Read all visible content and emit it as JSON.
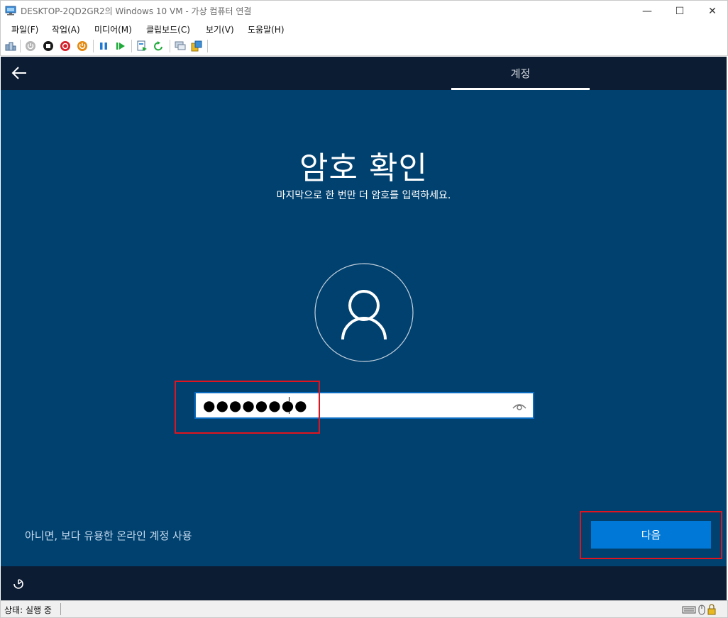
{
  "window": {
    "title": "DESKTOP-2QD2GR2의 Windows 10 VM - 가상 컴퓨터 연결",
    "minimize_symbol": "—",
    "maximize_symbol": "☐",
    "close_symbol": "✕"
  },
  "menu": {
    "items": [
      {
        "label": "파일(F)"
      },
      {
        "label": "작업(A)"
      },
      {
        "label": "미디어(M)"
      },
      {
        "label": "클립보드(C)"
      },
      {
        "label": "보기(V)"
      },
      {
        "label": "도움말(H)"
      }
    ]
  },
  "toolbar": {
    "icons": [
      "ctrl-alt-del-icon",
      "start-icon",
      "turn-off-icon",
      "shut-down-icon",
      "save-state-icon",
      "pause-icon",
      "resume-icon",
      "checkpoint-icon",
      "revert-icon",
      "enhanced-session-icon",
      "share-icon"
    ]
  },
  "oobe": {
    "tab_label": "계정",
    "heading": "암호 확인",
    "subheading": "마지막으로 한 번만 더 암호를 입력하세요.",
    "password_value": "●●●●●●●●",
    "alt_link": "아니면, 보다 유용한 온라인 계정 사용",
    "next_button": "다음"
  },
  "status": {
    "text": "상태: 실행 중"
  },
  "colors": {
    "background": "#00416f",
    "top_bar": "#0c1c33",
    "accent": "#0078d7",
    "highlight": "#e0141e"
  }
}
